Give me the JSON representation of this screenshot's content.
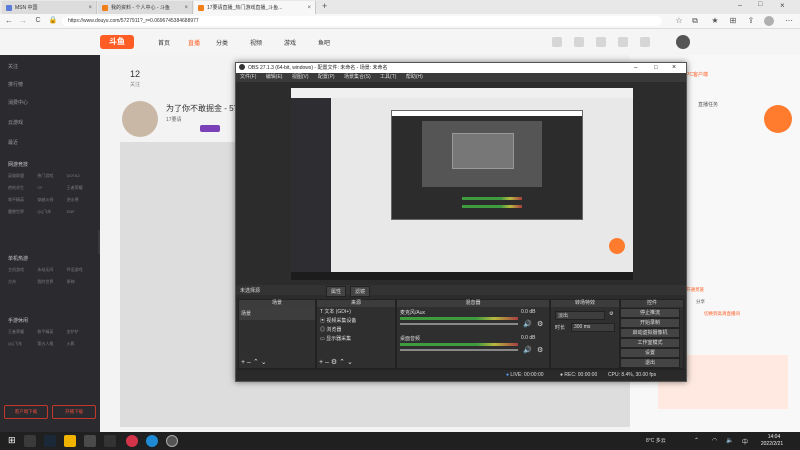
{
  "browser": {
    "tabs": [
      {
        "label": "MSN 中国",
        "color": "#5b7bd8"
      },
      {
        "label": "我的资料 - 个人中心 - 斗鱼",
        "color": "#f57f17"
      },
      {
        "label": "17要请直播_热门游戏直播_斗鱼...",
        "color": "#f57f17"
      }
    ],
    "new_tab": "+",
    "url": "https://www.douyu.com/5727911?_r=0.0696745384688977",
    "back": "←",
    "forward": "→",
    "reload": "C"
  },
  "site": {
    "logo": "斗鱼",
    "nav": [
      "首页",
      "直播",
      "分类",
      "视频",
      "游戏",
      "鱼吧"
    ],
    "room_count": "12",
    "room_label": "关注",
    "stream_title": "为了你不敢掘金 - 5727",
    "streamer": "17要请",
    "sidebar_items": [
      "关注",
      "排行榜",
      "消费中心",
      "云游戏",
      "最近"
    ],
    "sidebar_section1": "网游竞技",
    "sidebar_games1": [
      "英雄联盟",
      "热门游戏",
      "DOTA2",
      "绝地求生",
      "CF",
      "王者荣耀",
      "和平精英",
      "穿越火线",
      "逆水寒",
      "魔兽世界",
      "QQ飞车",
      "DNF"
    ],
    "sidebar_section2": "单机热游",
    "sidebar_games2": [
      "主机游戏",
      "永劫无间",
      "怀旧游戏",
      "方舟",
      "我的世界",
      "原神"
    ],
    "sidebar_section3": "手游休闲",
    "sidebar_games3": [
      "王者荣耀",
      "和平精英",
      "金铲铲",
      "QQ飞车",
      "第五人格",
      "火影"
    ],
    "sidebar_buttons": [
      "客户端下载",
      "开播下载"
    ],
    "right_texts": [
      "PC客户端",
      "直播任务",
      "开通贵族",
      "分享",
      "切换到高清直播间"
    ]
  },
  "obs": {
    "title": "OBS 27.1.3 (64-bit, windows) - 配置文件: 未命名 - 场景: 未命名",
    "menu": [
      "文件(F)",
      "编辑(E)",
      "视图(V)",
      "配置(P)",
      "场景集合(S)",
      "工具(T)",
      "帮助(H)"
    ],
    "scene_selected_label": "未选择源",
    "props_btn": "属性",
    "filter_btn": "滤镜",
    "panels": {
      "scenes": "场景",
      "sources": "来源",
      "mixer": "混音器",
      "transitions": "转场特效",
      "controls": "控件"
    },
    "scene_items": [
      "场景"
    ],
    "source_items": [
      "文本 (GDI+)",
      "视频采集设备",
      "浏览器",
      "显示器采集"
    ],
    "mixer_tracks": [
      {
        "name": "麦克风/Aux",
        "level": "0.0 dB"
      },
      {
        "name": "桌面音频",
        "level": "0.0 dB"
      }
    ],
    "transition": {
      "type": "淡出",
      "duration_label": "时长",
      "duration": "300 ms"
    },
    "controls": [
      "停止推流",
      "开始录制",
      "启动虚拟摄像机",
      "工作室模式",
      "设置",
      "退出"
    ],
    "status": {
      "live_label": "LIVE:",
      "live_time": "00:00:00",
      "rec_label": "REC:",
      "rec_time": "00:00:00",
      "cpu": "CPU: 8.4%, 30.00 fps"
    }
  },
  "taskbar": {
    "weather": "8°C 多云",
    "time": "14:04",
    "date": "2022/2/21"
  }
}
